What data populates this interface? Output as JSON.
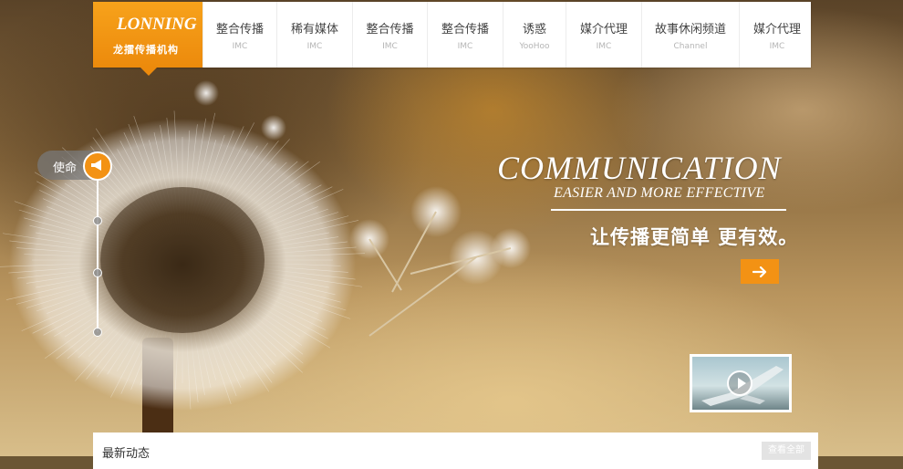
{
  "nav": {
    "logo_en": "LONNING",
    "logo_zh": "龙擂传播机构",
    "items": [
      {
        "zh": "整合传播",
        "en": "IMC"
      },
      {
        "zh": "稀有媒体",
        "en": "IMC"
      },
      {
        "zh": "整合传播",
        "en": "IMC"
      },
      {
        "zh": "整合传播",
        "en": "IMC"
      },
      {
        "zh": "诱惑",
        "en": "YooHoo"
      },
      {
        "zh": "媒介代理",
        "en": "IMC"
      },
      {
        "zh": "故事休闲频道",
        "en": "Channel"
      },
      {
        "zh": "媒介代理",
        "en": "IMC"
      }
    ]
  },
  "timeline": {
    "label": "使命",
    "icon": "megaphone-icon"
  },
  "hero": {
    "headline": "COMMUNICATION",
    "subline": "EASIER AND MORE EFFECTIVE",
    "tagline": "让传播更简单 更有效。",
    "go_icon": "arrow-right-icon"
  },
  "video": {
    "icon": "play-icon"
  },
  "news": {
    "title": "最新动态",
    "more": "查看全部"
  },
  "colors": {
    "accent": "#f39214",
    "nav_text": "#444444",
    "nav_sub": "#b5b5b5"
  }
}
